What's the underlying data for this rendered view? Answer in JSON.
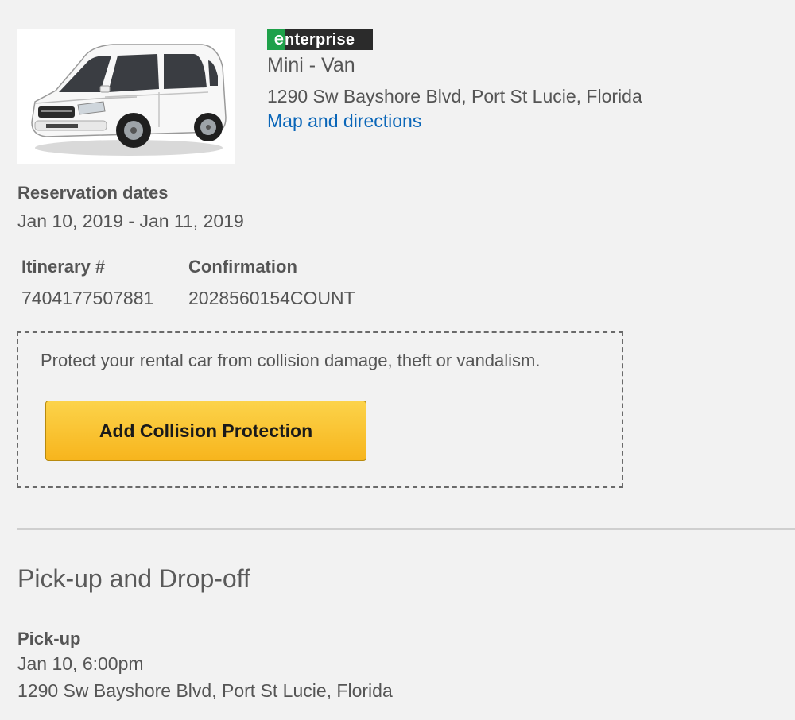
{
  "vendor": {
    "logo_initial": "e",
    "logo_rest": "nterprise",
    "brand_color": "#1fa14a"
  },
  "car": {
    "class": "Mini - Van",
    "address": "1290 Sw Bayshore Blvd, Port St Lucie, Florida",
    "map_link": "Map and directions",
    "image_subject": "white minivan"
  },
  "reservation": {
    "dates_label": "Reservation dates",
    "dates_value": "Jan 10, 2019 - Jan 11, 2019",
    "itinerary_label": "Itinerary #",
    "itinerary_value": "7404177507881",
    "confirmation_label": "Confirmation",
    "confirmation_value": "2028560154COUNT"
  },
  "protection": {
    "text": "Protect your rental car from collision damage, theft or vandalism.",
    "button_label": "Add Collision Protection",
    "button_color": "#fcc12f"
  },
  "pickup_dropoff": {
    "section_title": "Pick-up and Drop-off",
    "pickup_label": "Pick-up",
    "pickup_date": "Jan 10, 6:00pm",
    "pickup_address": "1290 Sw Bayshore Blvd, Port St Lucie, Florida"
  },
  "colors": {
    "background": "#f2f2f2",
    "text": "#555555",
    "link": "#0a66b8"
  }
}
